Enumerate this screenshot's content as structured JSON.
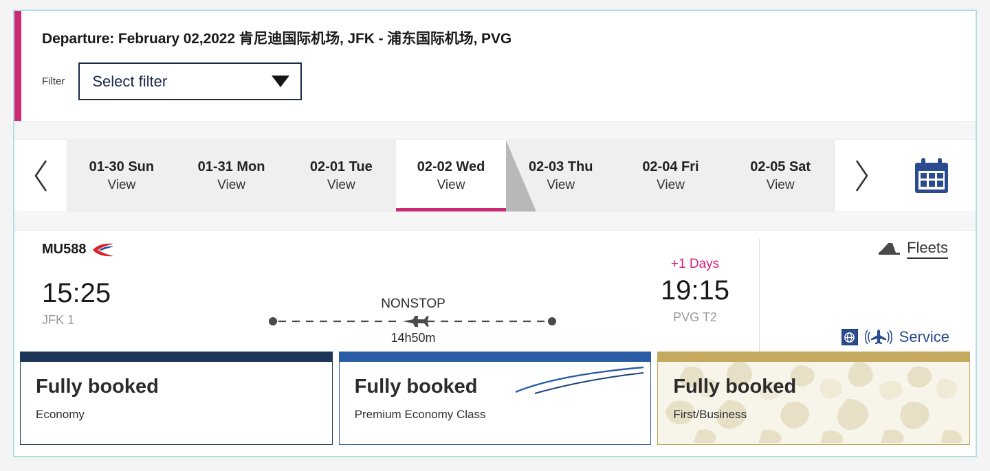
{
  "theme": {
    "panel_border": "#b2dde5",
    "accent_magenta": "#cc2a74",
    "navy": "#1b2a4a",
    "service_blue": "#2a4b8d",
    "gold": "#c5a95f"
  },
  "header": {
    "title": "Departure: February 02,2022 肯尼迪国际机场, JFK - 浦东国际机场, PVG",
    "filter_label": "Filter",
    "filter_value": "Select filter",
    "caret_icon": "chevron-down-icon"
  },
  "datestrip": {
    "prev_icon": "chevron-left-icon",
    "next_icon": "chevron-right-icon",
    "calendar_icon": "calendar-icon",
    "tabs": [
      {
        "date": "01-30 Sun",
        "action": "View",
        "active": false
      },
      {
        "date": "01-31 Mon",
        "action": "View",
        "active": false
      },
      {
        "date": "02-01 Tue",
        "action": "View",
        "active": false
      },
      {
        "date": "02-02 Wed",
        "action": "View",
        "active": true
      },
      {
        "date": "02-03 Thu",
        "action": "View",
        "active": false
      },
      {
        "date": "02-04 Fri",
        "action": "View",
        "active": false
      },
      {
        "date": "02-05 Sat",
        "action": "View",
        "active": false
      }
    ]
  },
  "flight": {
    "number": "MU588",
    "airline_logo_icon": "china-eastern-logo-icon",
    "departure_time": "15:25",
    "departure_terminal": "JFK 1",
    "stops": "NONSTOP",
    "duration": "14h50m",
    "plane_icon": "airplane-icon",
    "arrival_offset": "+1 Days",
    "arrival_time": "19:15",
    "arrival_terminal": "PVG T2",
    "fleets_label": "Fleets",
    "fleets_icon": "aircraft-tail-icon",
    "service_label": "Service",
    "service_globe_icon": "globe-icon",
    "service_wifi_icon": "inflight-wifi-icon"
  },
  "fares": [
    {
      "status": "Fully booked",
      "cabin": "Economy"
    },
    {
      "status": "Fully booked",
      "cabin": "Premium Economy Class"
    },
    {
      "status": "Fully booked",
      "cabin": "First/Business"
    }
  ]
}
